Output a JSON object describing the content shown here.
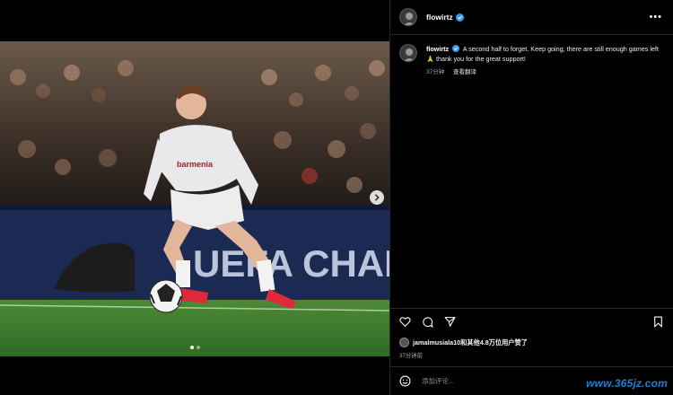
{
  "post": {
    "username": "flowirtz",
    "caption": "A second half to forget. Keep going, there are still enough games left 🙏 thank you for the great support!",
    "caption_time": "37分钟",
    "translate_label": "查看翻译",
    "likes_text": "jamalmusiala10和其他4.8万位用户赞了",
    "time": "37分钟前",
    "comment_placeholder": "添加评论..."
  },
  "media": {
    "sponsor_text": "barmenia",
    "board_text": "UEFA CHAMPIONS L",
    "carousel": {
      "count": 2,
      "active": 0
    }
  },
  "watermark": "www.365jz.com",
  "colors": {
    "background": "#000000",
    "verified": "#3897f0",
    "pitch": "#3e7a2e",
    "board": "#1b2a52",
    "watermark": "#1e7fd8"
  },
  "icons": [
    "more-icon",
    "verified-icon",
    "heart-icon",
    "comment-icon",
    "share-icon",
    "bookmark-icon",
    "emoji-icon",
    "next-arrow-icon"
  ]
}
